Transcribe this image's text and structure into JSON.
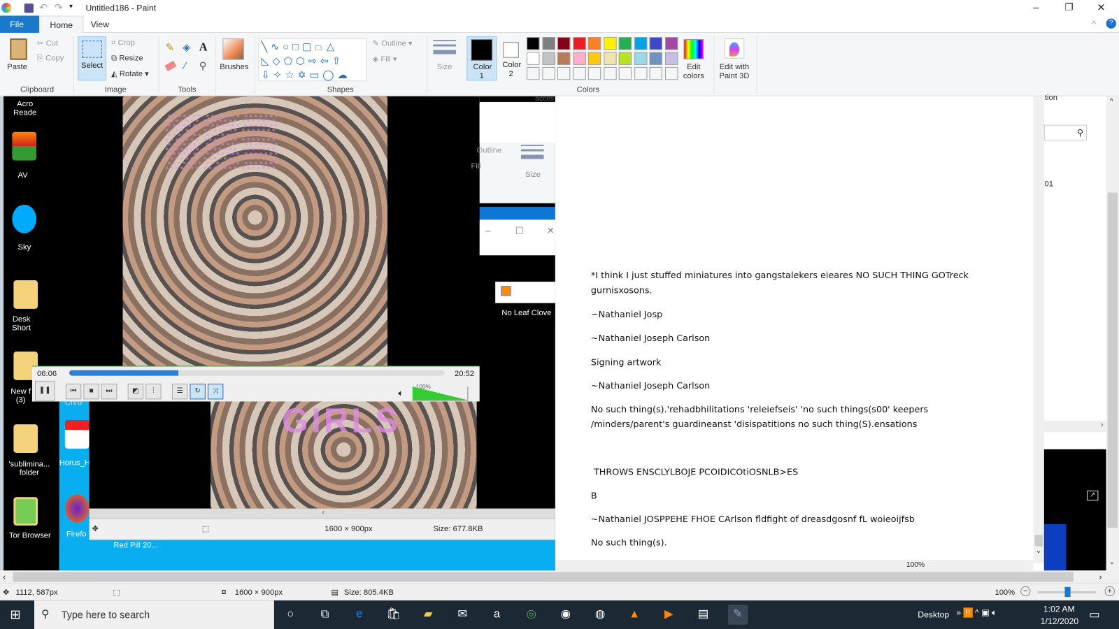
{
  "window": {
    "title": "Untitled186 - Paint",
    "minimize": "–",
    "maximize": "❐",
    "close": "✕"
  },
  "tabs": [
    {
      "label": "File"
    },
    {
      "label": "Home"
    },
    {
      "label": "View"
    }
  ],
  "ribbon": {
    "clipboard": {
      "label": "Clipboard",
      "paste": "Paste",
      "cut": "Cut",
      "copy": "Copy"
    },
    "image": {
      "label": "Image",
      "select": "Select",
      "crop": "Crop",
      "resize": "Resize",
      "rotate": "Rotate"
    },
    "tools": {
      "label": "Tools"
    },
    "brushes": "Brushes",
    "shapes": {
      "label": "Shapes",
      "outline": "Outline",
      "fill": "Fill"
    },
    "size": "Size",
    "color1": "Color 1",
    "color2": "Color 2",
    "colors": {
      "label": "Colors",
      "row1": [
        "#000000",
        "#7f7f7f",
        "#880015",
        "#ed1c24",
        "#ff7f27",
        "#fff200",
        "#22b14c",
        "#00a2e8",
        "#3f48cc",
        "#a349a4"
      ],
      "row2": [
        "#ffffff",
        "#c3c3c3",
        "#b97a57",
        "#ffaec9",
        "#ffc90e",
        "#efe4b0",
        "#b5e61d",
        "#99d9ea",
        "#7092be",
        "#c8bfe7"
      ]
    },
    "edit_colors": "Edit colors",
    "paint3d": "Edit with Paint 3D"
  },
  "pasted": {
    "desktop_icons": [
      "Acro Reade",
      "AV",
      "Sky",
      "Desk Short",
      "New f (3)",
      "'sublimina... folder",
      "Tor Browser",
      "Horus_H",
      "Firefo",
      "Sky",
      "Chro",
      "Red Pill 20..."
    ],
    "video_overlay_text": [
      "GIRLS"
    ],
    "vlc": {
      "elapsed": "06:06",
      "total": "20:52",
      "progress": 0.29,
      "volume": "100%",
      "volume_level": 1.0
    },
    "nested_paint": {
      "size_label": "Size",
      "outline": "Outline",
      "fill": "Fill",
      "dims": "1600 × 900px",
      "filesize": "Size: 677.8KB",
      "acces": "acces",
      "zoom": "100%"
    },
    "now_playing": "No Leaf Clove",
    "right_panel": {
      "fragment1": "tion",
      "fragment2": "-01"
    }
  },
  "document": {
    "paragraphs": [
      "*I think I just stuffed miniatures into gangstalekers eieares NO SUCH THING GOTreck gurnisxosons.",
      "~Nathaniel Josp",
      "~Nathaniel Joseph Carlson",
      "Signing artwork",
      "~Nathaniel Joseph Carlson",
      "No such thing(s).'rehadbhilitations 'releiefseis' 'no such things(s00' keepers /minders/parent's guardineanst 'disispatitions no such thing(S).ensations",
      " THROWS ENSCLYLBOJE PCOIDICOtiOSNLB>ES",
      "B",
      "~Nathaniel JOSPPEHE FHOE CArlson fldfight of dreasdgosnf fL woieoijfsb",
      "No such thing(s)."
    ]
  },
  "statusbar": {
    "cursor": "1112, 587px",
    "dims": "1600 × 900px",
    "filesize": "Size: 805.4KB",
    "zoom": "100%"
  },
  "taskbar": {
    "search_placeholder": "Type here to search",
    "desktop": "Desktop",
    "time": "1:02 AM",
    "date": "1/12/2020",
    "apps": [
      "cortana",
      "task-view",
      "edge",
      "store",
      "file-explorer",
      "mail",
      "amazon",
      "tripadvisor",
      "camera-app",
      "color-app",
      "vlc",
      "media-player",
      "notepad-doc",
      "paint"
    ]
  }
}
